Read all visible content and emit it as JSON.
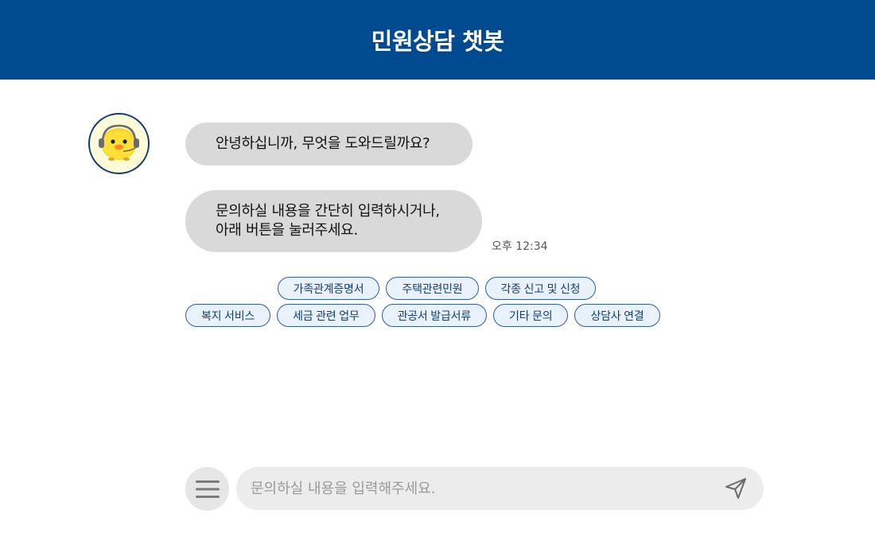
{
  "header": {
    "title": "민원상담 챗봇"
  },
  "chat": {
    "messages": [
      {
        "lines": [
          "안녕하십니까, 무엇을 도와드릴까요?"
        ]
      },
      {
        "lines": [
          "문의하실 내용을 간단히 입력하시거나,",
          "아래 버튼을 눌러주세요."
        ]
      }
    ],
    "timestamp": "오후 12:34"
  },
  "quick_replies": {
    "row1": [
      "가족관계증명서",
      "주택관련민원",
      "각종 신고 및 신청"
    ],
    "row2": [
      "복지 서비스",
      "세금 관련 업무",
      "관공서 발급서류",
      "기타 문의",
      "상담사 연결"
    ]
  },
  "input": {
    "placeholder": "문의하실 내용을 입력해주세요.",
    "value": ""
  },
  "icons": {
    "menu": "hamburger-menu-icon",
    "send": "paper-plane-send-icon",
    "avatar": "chick-mascot-with-headset"
  },
  "colors": {
    "header_bg": "#004a8f",
    "chip_border": "#2f5f9a",
    "chip_bg": "#e9f1fb",
    "bubble_bg": "#d9d9d9"
  }
}
